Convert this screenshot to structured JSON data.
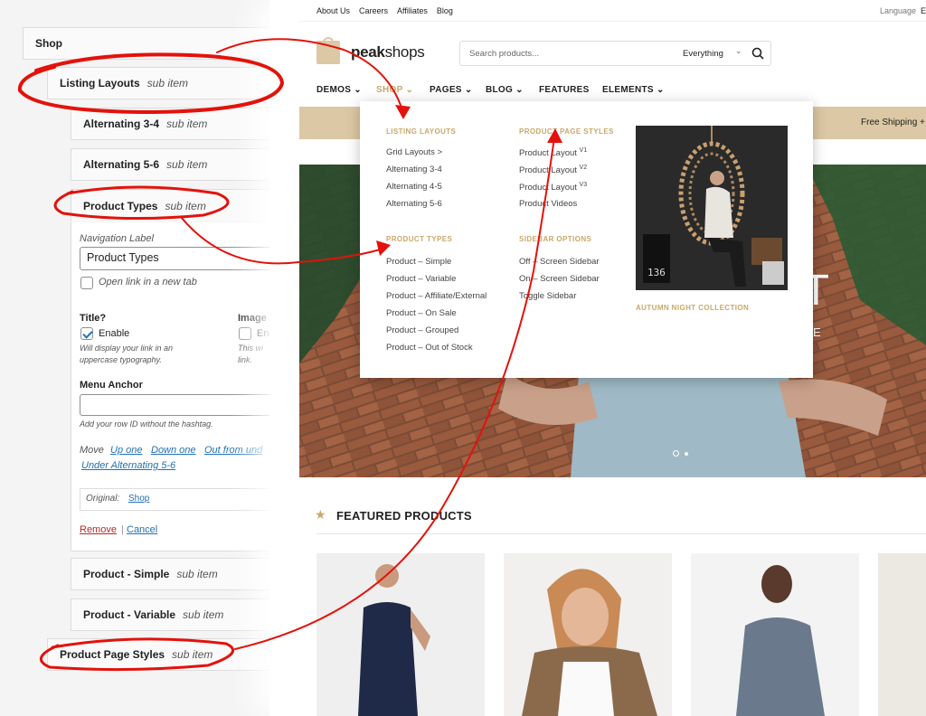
{
  "admin": {
    "menu": [
      {
        "label": "Shop",
        "sub": ""
      },
      {
        "label": "Listing Layouts",
        "sub": "sub item"
      },
      {
        "label": "Alternating 3-4",
        "sub": "sub item"
      },
      {
        "label": "Alternating 5-6",
        "sub": "sub item"
      },
      {
        "label": "Product Types",
        "sub": "sub item"
      },
      {
        "label": "Product - Simple",
        "sub": "sub item"
      },
      {
        "label": "Product - Variable",
        "sub": "sub item"
      },
      {
        "label": "Product Page Styles",
        "sub": "sub item"
      }
    ],
    "settings": {
      "nav_label_title": "Navigation Label",
      "nav_label_value": "Product Types",
      "new_tab_label": "Open link in a new tab",
      "title_heading": "Title?",
      "title_enable": "Enable",
      "title_desc": "Will display your link in an uppercase typography.",
      "image_heading": "Image",
      "image_enable": "En",
      "image_desc": "This wi link.",
      "anchor_heading": "Menu Anchor",
      "anchor_desc": "Add your row ID without the hashtag.",
      "move_label": "Move",
      "move_up": "Up one",
      "move_down": "Down one",
      "move_out": "Out from und",
      "move_under": "Under Alternating 5-6",
      "original_label": "Original:",
      "original_link": "Shop",
      "remove": "Remove",
      "separator": "|",
      "cancel": "Cancel"
    }
  },
  "store": {
    "top_links": [
      "About Us",
      "Careers",
      "Affiliates",
      "Blog"
    ],
    "language": "Language",
    "language_flag": "E",
    "logo_text_bold": "peak",
    "logo_text_light": "shops",
    "search_placeholder": "Search products...",
    "search_scope": "Everything",
    "nav": [
      "DEMOS",
      "SHOP",
      "PAGES",
      "BLOG",
      "FEATURES",
      "ELEMENTS"
    ],
    "nav_dropdown": [
      true,
      true,
      true,
      true,
      false,
      true
    ],
    "banner_text": "Free Shipping +",
    "hero_text_big": "UT",
    "hero_text_small": "E",
    "featured_title": "FEATURED PRODUCTS"
  },
  "mega": {
    "col1_heading": "LISTING LAYOUTS",
    "col1_items": [
      "Grid Layouts  >",
      "Alternating 3-4",
      "Alternating 4-5",
      "Alternating 5-6"
    ],
    "col1b_heading": "PRODUCT TYPES",
    "col1b_items": [
      "Product – Simple",
      "Product – Variable",
      "Product – Affiliate/External",
      "Product – On Sale",
      "Product – Grouped",
      "Product – Out of Stock"
    ],
    "col2_heading": "PRODUCT PAGE STYLES",
    "col2_items": [
      "Product Layout",
      "Product Layout",
      "Product Layout",
      "Product Videos"
    ],
    "col2_sups": [
      "V1",
      "V2",
      "V3",
      ""
    ],
    "col2b_heading": "SIDEBAR OPTIONS",
    "col2b_items": [
      "Off – Screen Sidebar",
      "On – Screen Sidebar",
      "Toggle Sidebar"
    ],
    "promo_caption": "AUTUMN NIGHT COLLECTION",
    "promo_number": "136"
  },
  "colors": {
    "accent": "#c9a86a",
    "banner": "#dcc8a4",
    "annotation": "#e3120b",
    "link": "#2271b1"
  }
}
